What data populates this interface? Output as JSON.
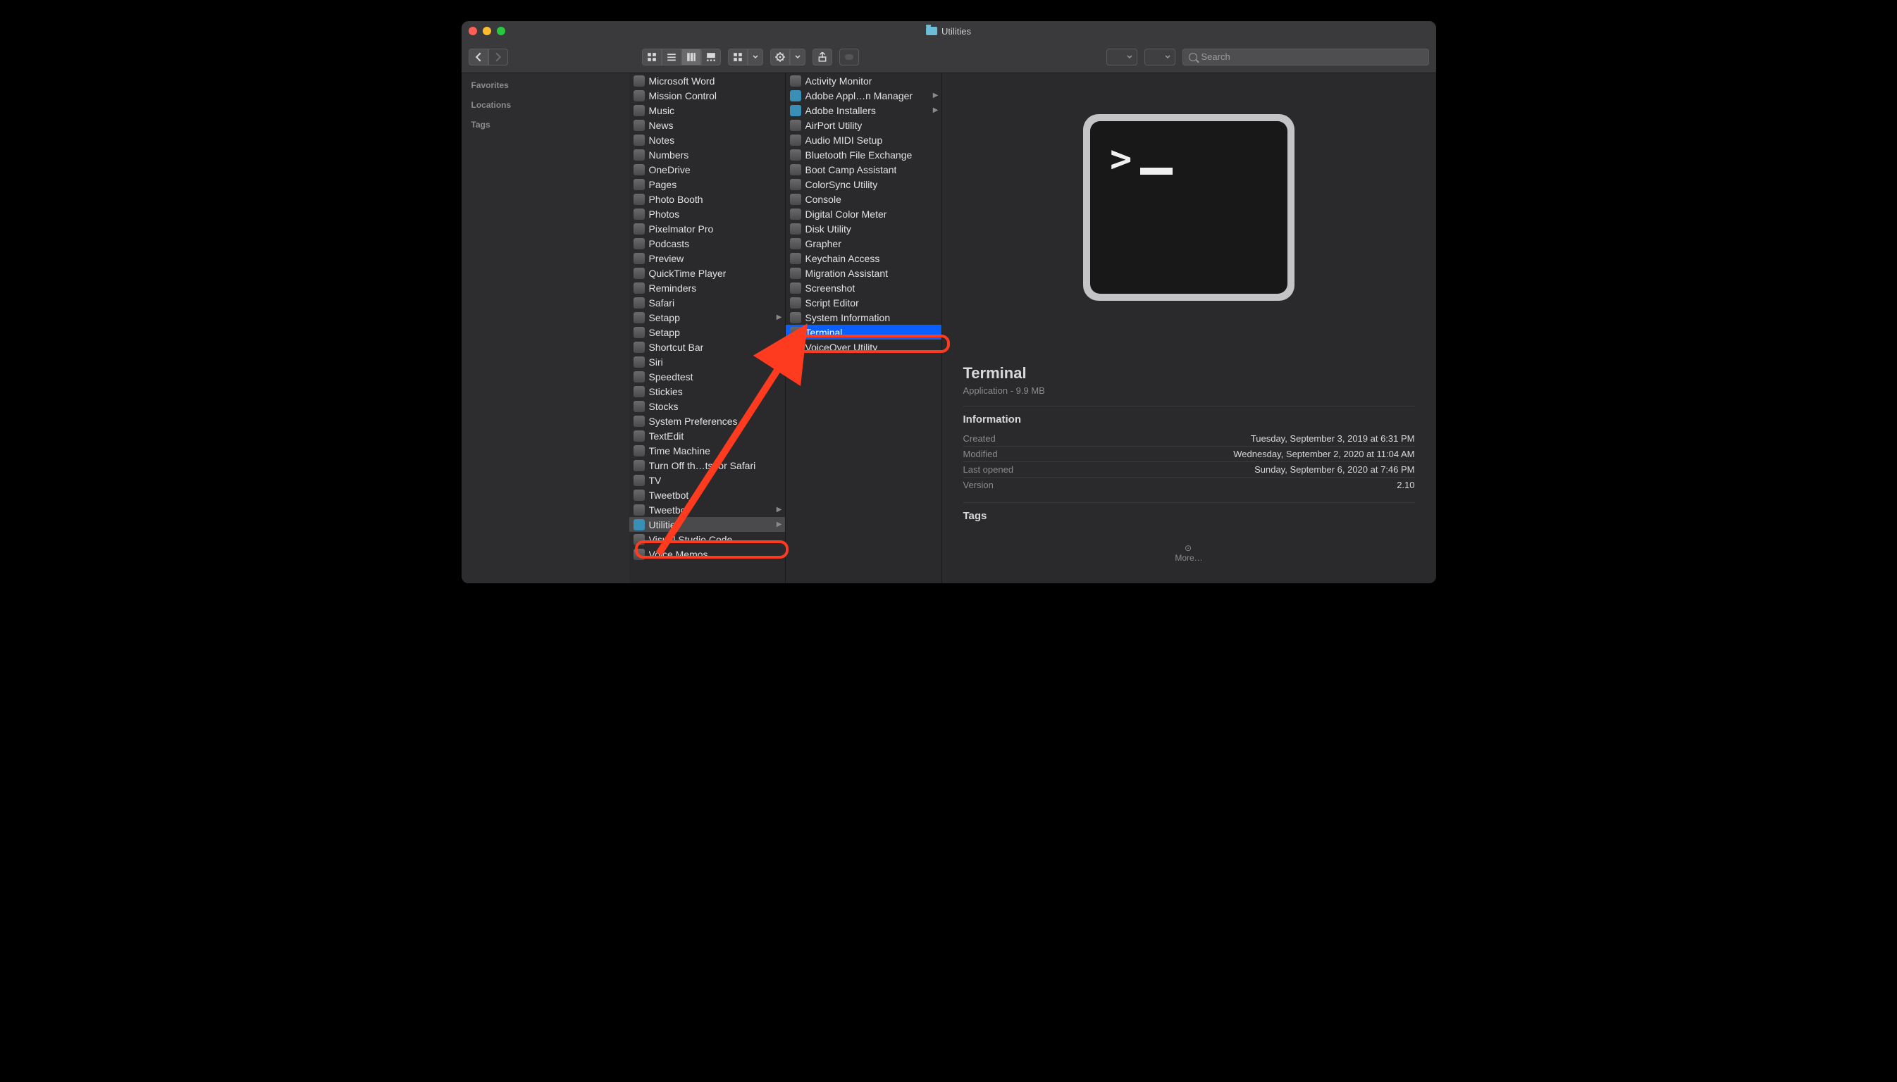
{
  "window": {
    "title": "Utilities"
  },
  "toolbar": {
    "search_placeholder": "Search"
  },
  "sidebar": {
    "sections": [
      "Favorites",
      "Locations",
      "Tags"
    ]
  },
  "col_apps": [
    {
      "label": "Microsoft Word"
    },
    {
      "label": "Mission Control"
    },
    {
      "label": "Music"
    },
    {
      "label": "News"
    },
    {
      "label": "Notes"
    },
    {
      "label": "Numbers"
    },
    {
      "label": "OneDrive"
    },
    {
      "label": "Pages"
    },
    {
      "label": "Photo Booth"
    },
    {
      "label": "Photos"
    },
    {
      "label": "Pixelmator Pro"
    },
    {
      "label": "Podcasts"
    },
    {
      "label": "Preview"
    },
    {
      "label": "QuickTime Player"
    },
    {
      "label": "Reminders"
    },
    {
      "label": "Safari"
    },
    {
      "label": "Setapp",
      "arrow": true
    },
    {
      "label": "Setapp"
    },
    {
      "label": "Shortcut Bar"
    },
    {
      "label": "Siri"
    },
    {
      "label": "Speedtest"
    },
    {
      "label": "Stickies"
    },
    {
      "label": "Stocks"
    },
    {
      "label": "System Preferences"
    },
    {
      "label": "TextEdit"
    },
    {
      "label": "Time Machine"
    },
    {
      "label": "Turn Off th…ts for Safari"
    },
    {
      "label": "TV"
    },
    {
      "label": "Tweetbot"
    },
    {
      "label": "Tweetbot",
      "arrow": true
    },
    {
      "label": "Utilities",
      "arrow": true,
      "selected": true,
      "folder": true
    },
    {
      "label": "Visual Studio Code"
    },
    {
      "label": "Voice Memos"
    }
  ],
  "col_util": [
    {
      "label": "Activity Monitor"
    },
    {
      "label": "Adobe Appl…n Manager",
      "arrow": true,
      "folder": true
    },
    {
      "label": "Adobe Installers",
      "arrow": true,
      "folder": true
    },
    {
      "label": "AirPort Utility"
    },
    {
      "label": "Audio MIDI Setup"
    },
    {
      "label": "Bluetooth File Exchange"
    },
    {
      "label": "Boot Camp Assistant"
    },
    {
      "label": "ColorSync Utility"
    },
    {
      "label": "Console"
    },
    {
      "label": "Digital Color Meter"
    },
    {
      "label": "Disk Utility"
    },
    {
      "label": "Grapher"
    },
    {
      "label": "Keychain Access"
    },
    {
      "label": "Migration Assistant"
    },
    {
      "label": "Screenshot"
    },
    {
      "label": "Script Editor"
    },
    {
      "label": "System Information"
    },
    {
      "label": "Terminal",
      "selected": true
    },
    {
      "label": "VoiceOver Utility"
    }
  ],
  "preview": {
    "name": "Terminal",
    "subtitle": "Application - 9.9 MB",
    "info_heading": "Information",
    "rows": [
      {
        "key": "Created",
        "val": "Tuesday, September 3, 2019 at 6:31 PM"
      },
      {
        "key": "Modified",
        "val": "Wednesday, September 2, 2020 at 11:04 AM"
      },
      {
        "key": "Last opened",
        "val": "Sunday, September 6, 2020 at 7:46 PM"
      },
      {
        "key": "Version",
        "val": "2.10"
      }
    ],
    "tags_heading": "Tags",
    "more_label": "More…"
  }
}
